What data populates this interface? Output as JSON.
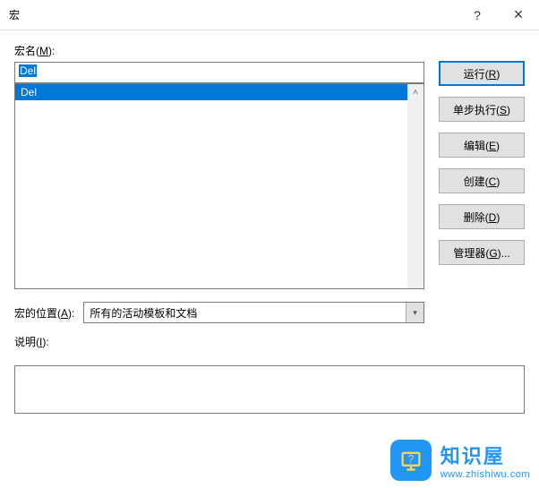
{
  "titlebar": {
    "title": "宏",
    "help": "?",
    "close": "×"
  },
  "labels": {
    "macro_name_pre": "宏名(",
    "macro_name_mn": "M",
    "macro_name_post": "):",
    "location_pre": "宏的位置(",
    "location_mn": "A",
    "location_post": "):",
    "desc_pre": "说明(",
    "desc_mn": "I",
    "desc_post": "):"
  },
  "name_input": {
    "value": "Del"
  },
  "list": {
    "items": [
      "Del"
    ],
    "selected": 0
  },
  "location_select": {
    "value": "所有的活动模板和文档"
  },
  "buttons": {
    "run": "运行(R)",
    "step": "单步执行(S)",
    "edit": "编辑(E)",
    "create": "创建(C)",
    "delete": "删除(D)",
    "organizer": "管理器(G)..."
  },
  "watermark": {
    "zh": "知识屋",
    "url": "www.zhishiwu.com"
  }
}
